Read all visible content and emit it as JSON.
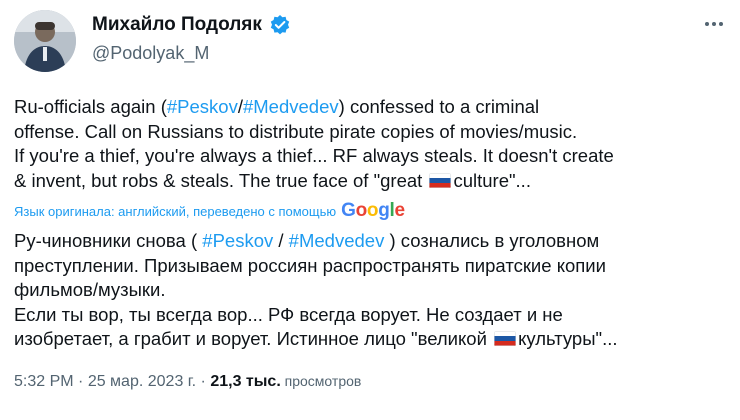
{
  "author": {
    "display_name": "Михайло Подоляк",
    "handle": "@Podolyak_M",
    "avatar_icon": "person-avatar",
    "verified_icon": "verified-badge-icon",
    "verified_color": "#1d9bf0"
  },
  "menu_icon": "more-options-icon",
  "original_text": {
    "line1_a": "Ru-officials again (",
    "line1_tag1": "#Peskov",
    "line1_sep": "/",
    "line1_tag2": "#Medvedev",
    "line1_b": ") confessed to a criminal",
    "line2": "offense. Call on Russians to distribute pirate copies of movies/music.",
    "line3": "If you're a thief, you're always a thief... RF always steals. It doesn't create",
    "line4_a": "& invent, but robs & steals. The true face of \"great ",
    "line4_b": "culture\"..."
  },
  "translation_note": {
    "text": "Язык оригинала: английский, переведено с помощью",
    "logo_letters": [
      "G",
      "o",
      "o",
      "g",
      "l",
      "e"
    ]
  },
  "translated_text": {
    "line1_a": "Ру-чиновники снова ( ",
    "line1_tag1": "#Peskov",
    "line1_sep": " / ",
    "line1_tag2": "#Medvedev",
    "line1_b": " ) сознались в уголовном",
    "line2": "преступлении. Призываем россиян распространять пиратские копии",
    "line3": "фильмов/музыки.",
    "line4": "Если ты вор, ты всегда вор... РФ всегда ворует. Не создает и не",
    "line5_a": "изобретает, а грабит и ворует. Истинное лицо \"великой ",
    "line5_b": "культуры\"..."
  },
  "meta": {
    "time": "5:32 PM",
    "dot1": " · ",
    "date": "25 мар. 2023 г.",
    "dot2": " · ",
    "views_count": "21,3 тыс.",
    "views_label": " просмотров"
  },
  "colors": {
    "link": "#1d9bf0",
    "text": "#0f1419",
    "secondary": "#536471"
  }
}
